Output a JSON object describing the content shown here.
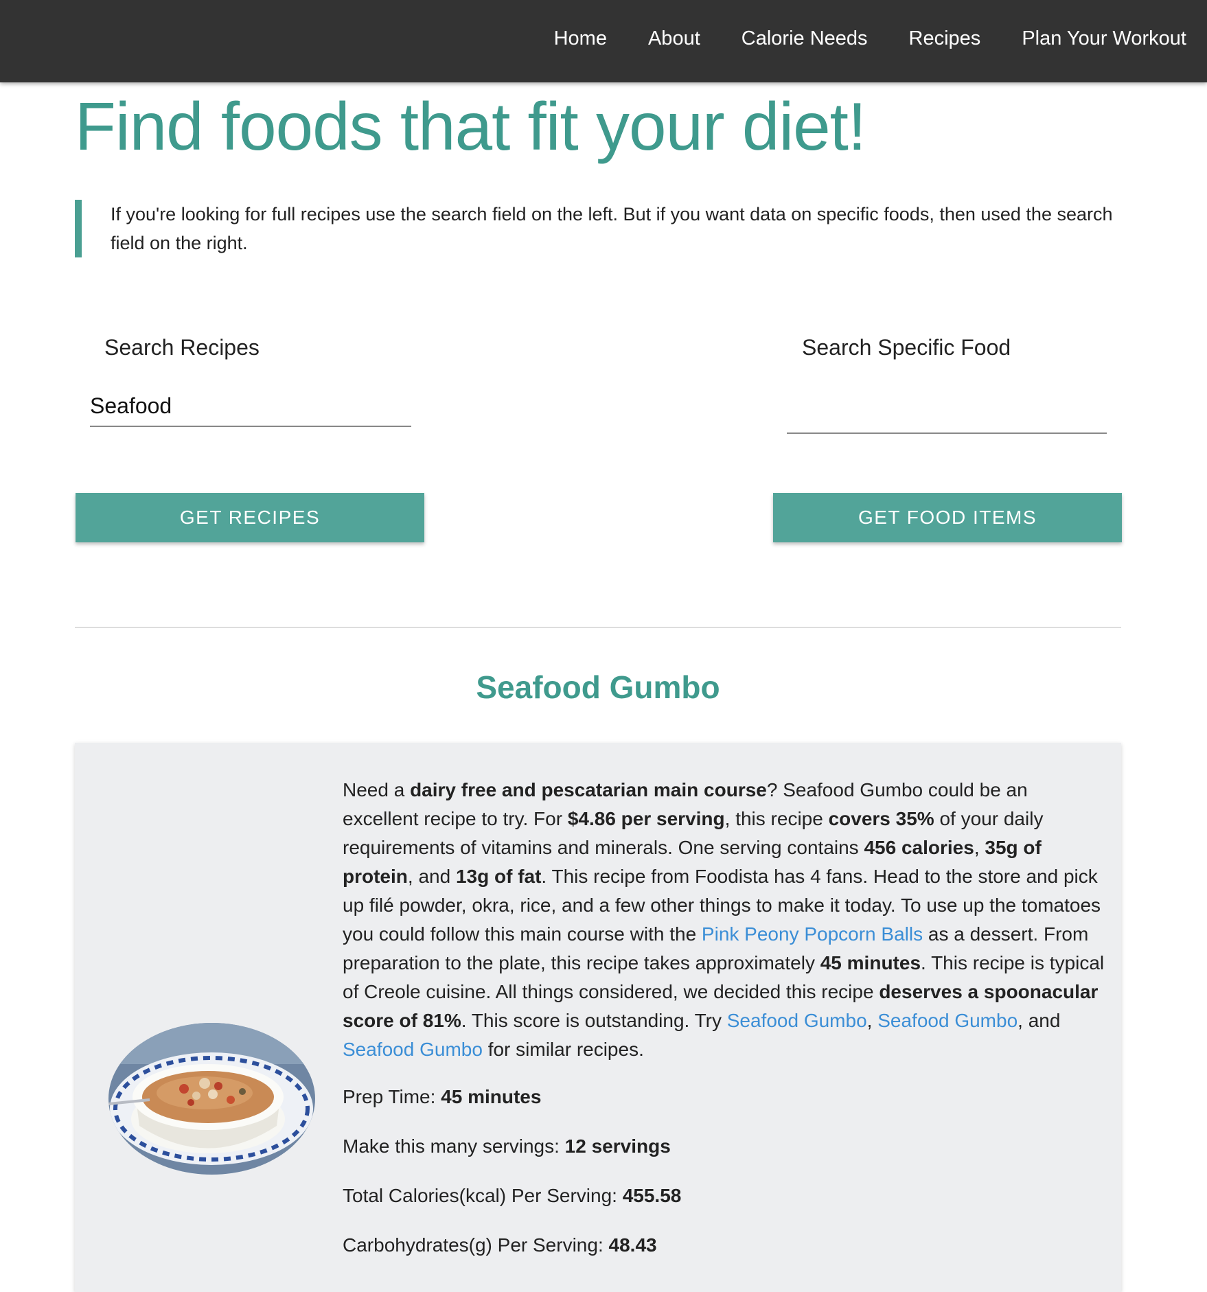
{
  "nav": {
    "items": [
      "Home",
      "About",
      "Calorie Needs",
      "Recipes",
      "Plan Your Workout"
    ]
  },
  "page": {
    "title": "Find foods that fit your diet!",
    "intro": "If you're looking for full recipes use the search field on the left. But if you want data on specific foods, then used the search field on the right."
  },
  "search_recipes": {
    "label": "Search Recipes",
    "value": "Seafood",
    "button": "Get Recipes"
  },
  "search_food": {
    "label": "Search Specific Food",
    "value": "",
    "button": "Get Food Items"
  },
  "recipe": {
    "title": "Seafood Gumbo",
    "image_alt": "Seafood Gumbo bowl",
    "summary": {
      "s1": "Need a ",
      "b1": "dairy free and pescatarian main course",
      "s2": "? Seafood Gumbo could be an excellent recipe to try. For ",
      "b2": "$4.86 per serving",
      "s3": ", this recipe ",
      "b3": "covers 35%",
      "s4": " of your daily requirements of vitamins and minerals. One serving contains ",
      "b4": "456 calories",
      "s5": ", ",
      "b5": "35g of protein",
      "s6": ", and ",
      "b6": "13g of fat",
      "s7": ". This recipe from Foodista has 4 fans. Head to the store and pick up filé powder, okra, rice, and a few other things to make it today. To use up the tomatoes you could follow this main course with the ",
      "link1": "Pink Peony Popcorn Balls",
      "s8": " as a dessert. From preparation to the plate, this recipe takes approximately ",
      "b7": "45 minutes",
      "s9": ". This recipe is typical of Creole cuisine. All things considered, we decided this recipe ",
      "b8": "deserves a spoonacular score of 81%",
      "s10": ". This score is outstanding. Try ",
      "link2": "Seafood Gumbo",
      "s11": ", ",
      "link3": "Seafood Gumbo",
      "s12": ", and ",
      "link4": "Seafood Gumbo",
      "s13": " for similar recipes."
    },
    "prep_time_label": "Prep Time: ",
    "prep_time_value": "45 minutes",
    "servings_label": "Make this many servings: ",
    "servings_value": "12 servings",
    "calories_label": "Total Calories(kcal) Per Serving: ",
    "calories_value": "455.58",
    "carbs_label": "Carbohydrates(g) Per Serving: ",
    "carbs_value": "48.43"
  },
  "colors": {
    "accent": "#3f9a8d",
    "button": "#52a499",
    "navbar": "#333333",
    "link": "#3b8ed6",
    "card": "#edeef0"
  }
}
